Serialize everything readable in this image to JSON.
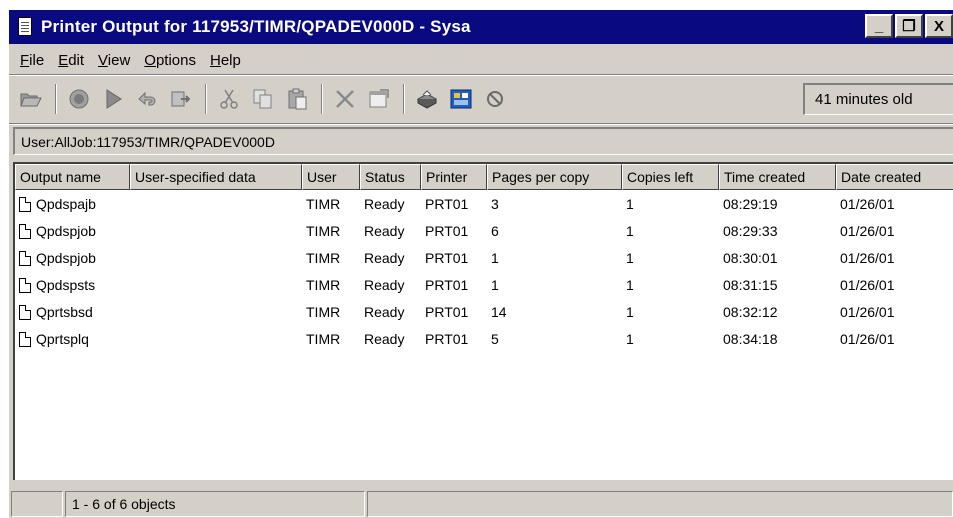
{
  "window": {
    "title": "Printer Output for 117953/TIMR/QPADEV000D  - Sysa",
    "buttons": [
      "_",
      "❐",
      "X"
    ]
  },
  "menu": [
    {
      "label": "File",
      "key": "F",
      "rest": "ile"
    },
    {
      "label": "Edit",
      "key": "E",
      "rest": "dit"
    },
    {
      "label": "View",
      "key": "V",
      "rest": "iew"
    },
    {
      "label": "Options",
      "key": "O",
      "rest": "ptions"
    },
    {
      "label": "Help",
      "key": "H",
      "rest": "elp"
    }
  ],
  "toolbar": {
    "icons": [
      "open-icon",
      "hold-icon",
      "release-icon",
      "reply-icon",
      "move-icon",
      "cut-icon",
      "copy-icon",
      "paste-icon",
      "delete-icon",
      "properties-icon",
      "printer-icon",
      "refresh-view-icon",
      "stop-icon"
    ],
    "age_text": "41 minutes old"
  },
  "infobar": {
    "user_label": "User:",
    "user_value": "All",
    "job_label": "Job:",
    "job_value": "117953/TIMR/QPADEV000D"
  },
  "table": {
    "columns": [
      "Output name",
      "User-specified data",
      "User",
      "Status",
      "Printer",
      "Pages per copy",
      "Copies left",
      "Time created",
      "Date created"
    ],
    "rows": [
      [
        "Qpdspajb",
        "",
        "TIMR",
        "Ready",
        "PRT01",
        "3",
        "1",
        "08:29:19",
        "01/26/01"
      ],
      [
        "Qpdspjob",
        "",
        "TIMR",
        "Ready",
        "PRT01",
        "6",
        "1",
        "08:29:33",
        "01/26/01"
      ],
      [
        "Qpdspjob",
        "",
        "TIMR",
        "Ready",
        "PRT01",
        "1",
        "1",
        "08:30:01",
        "01/26/01"
      ],
      [
        "Qpdspsts",
        "",
        "TIMR",
        "Ready",
        "PRT01",
        "1",
        "1",
        "08:31:15",
        "01/26/01"
      ],
      [
        "Qprtsbsd",
        "",
        "TIMR",
        "Ready",
        "PRT01",
        "14",
        "1",
        "08:32:12",
        "01/26/01"
      ],
      [
        "Qprtsplq",
        "",
        "TIMR",
        "Ready",
        "PRT01",
        "5",
        "1",
        "08:34:18",
        "01/26/01"
      ]
    ]
  },
  "status": {
    "count_text": "1 - 6 of 6 objects"
  },
  "colors": {
    "titlebar": "#0a0a80",
    "face": "#d4d0c8"
  }
}
